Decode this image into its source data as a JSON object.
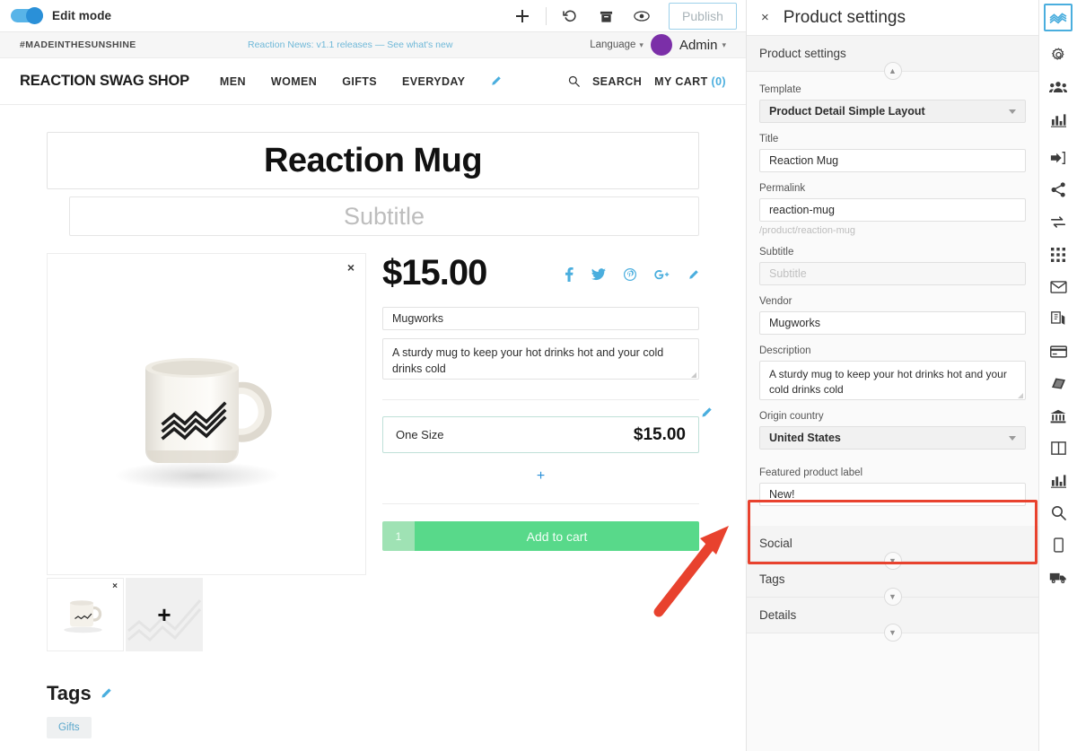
{
  "editbar": {
    "toggle_label": "Edit mode",
    "tools": [
      {
        "name": "add-icon",
        "label": "+"
      },
      {
        "name": "revert-icon",
        "label": "undo"
      },
      {
        "name": "archive-icon",
        "label": "archive"
      },
      {
        "name": "preview-icon",
        "label": "preview"
      }
    ],
    "publish_label": "Publish"
  },
  "shop": {
    "hashtag": "#MADEINTHESUNSHINE",
    "news": "Reaction News: v1.1 releases — See what's new",
    "language_label": "Language",
    "admin_label": "Admin",
    "brand": "REACTION SWAG SHOP",
    "nav": [
      "MEN",
      "WOMEN",
      "GIFTS",
      "EVERYDAY"
    ],
    "search_label": "SEARCH",
    "cart_label": "MY CART",
    "cart_count": "(0)"
  },
  "product": {
    "title": "Reaction Mug",
    "subtitle_placeholder": "Subtitle",
    "price": "$15.00",
    "vendor": "Mugworks",
    "description": "A sturdy mug to keep your hot drinks hot and your cold drinks cold",
    "variant_name": "One Size",
    "variant_price": "$15.00",
    "add_variant_label": "+",
    "qty": "1",
    "add_to_cart_label": "Add to cart",
    "tags_heading": "Tags",
    "tags": [
      "Gifts"
    ],
    "image_remove_label": "×",
    "thumb_remove_label": "×",
    "thumb_add_label": "+",
    "socials": [
      "facebook-icon",
      "twitter-icon",
      "pinterest-icon",
      "googleplus-icon",
      "edit-pencil-icon"
    ]
  },
  "panel": {
    "close_label": "×",
    "title": "Product settings",
    "sections": {
      "product_settings": {
        "header": "Product settings",
        "fields": {
          "template": {
            "label": "Template",
            "value": "Product Detail Simple Layout"
          },
          "title": {
            "label": "Title",
            "value": "Reaction Mug"
          },
          "permalink": {
            "label": "Permalink",
            "value": "reaction-mug",
            "hint": "/product/reaction-mug"
          },
          "subtitle": {
            "label": "Subtitle",
            "value": "",
            "placeholder": "Subtitle"
          },
          "vendor": {
            "label": "Vendor",
            "value": "Mugworks"
          },
          "description": {
            "label": "Description",
            "value": "A sturdy mug to keep your hot drinks hot and your cold drinks cold"
          },
          "origin_country": {
            "label": "Origin country",
            "value": "United States"
          },
          "featured_product_label": {
            "label": "Featured product label",
            "value": "New!"
          }
        }
      },
      "social": {
        "header": "Social"
      },
      "tags": {
        "header": "Tags"
      },
      "details": {
        "header": "Details"
      }
    }
  },
  "rail": {
    "items": [
      {
        "name": "reaction-logo-icon",
        "active": true
      },
      {
        "name": "gear-icon",
        "active": false
      },
      {
        "name": "accounts-icon",
        "active": false
      },
      {
        "name": "dashboard-chart-icon",
        "active": false
      },
      {
        "name": "login-icon",
        "active": false
      },
      {
        "name": "share-icon",
        "active": false
      },
      {
        "name": "connections-icon",
        "active": false
      },
      {
        "name": "grid-apps-icon",
        "active": false
      },
      {
        "name": "email-icon",
        "active": false
      },
      {
        "name": "pages-icon",
        "active": false
      },
      {
        "name": "payments-card-icon",
        "active": false
      },
      {
        "name": "catalog-book-icon",
        "active": false
      },
      {
        "name": "taxes-bank-icon",
        "active": false
      },
      {
        "name": "layout-columns-icon",
        "active": false
      },
      {
        "name": "analytics-icon",
        "active": false
      },
      {
        "name": "search-icon",
        "active": false
      },
      {
        "name": "mobile-device-icon",
        "active": false
      },
      {
        "name": "shipping-truck-icon",
        "active": false
      }
    ]
  },
  "colors": {
    "accent_blue": "#4aaede",
    "cart_green": "#58d98a",
    "annotation_red": "#e8422e",
    "avatar_purple": "#7b2fa8"
  }
}
